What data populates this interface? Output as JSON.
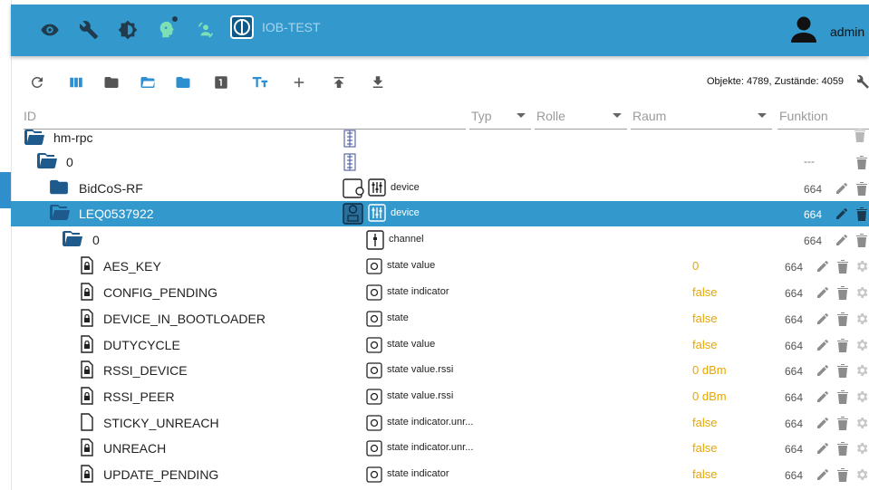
{
  "appbar": {
    "instance": "IOB-TEST",
    "user": "admin",
    "icons": [
      "eye-icon",
      "wrench-icon",
      "brightness-icon",
      "robot-head-icon",
      "person-sync-icon"
    ]
  },
  "toolbar": {
    "counts": "Objekte: 4789, Zustände: 4059",
    "icons": [
      "refresh-icon",
      "columns-icon",
      "folder-icon",
      "folder-open-icon",
      "folder-blue-icon",
      "number-one-icon",
      "text-size-icon",
      "add-icon",
      "upload-icon",
      "download-icon"
    ]
  },
  "columns": {
    "id": "ID",
    "type": "Typ",
    "role": "Rolle",
    "room": "Raum",
    "function": "Funktion"
  },
  "rows": [
    {
      "name": "hm-rpc",
      "role": "",
      "value": "",
      "acl": "",
      "selected": false
    },
    {
      "name": "0",
      "role": "",
      "value": "",
      "acl": "---",
      "selected": false
    },
    {
      "name": "BidCoS-RF",
      "role": "device",
      "value": "",
      "acl": "664",
      "selected": false
    },
    {
      "name": "LEQ0537922",
      "role": "device",
      "value": "",
      "acl": "664",
      "selected": true
    },
    {
      "name": "0",
      "role": "channel",
      "value": "",
      "acl": "664",
      "selected": false
    },
    {
      "name": "AES_KEY",
      "role": "state value",
      "value": "0",
      "acl": "664",
      "selected": false
    },
    {
      "name": "CONFIG_PENDING",
      "role": "state indicator",
      "value": "false",
      "acl": "664",
      "selected": false
    },
    {
      "name": "DEVICE_IN_BOOTLOADER",
      "role": "state",
      "value": "false",
      "acl": "664",
      "selected": false
    },
    {
      "name": "DUTYCYCLE",
      "role": "state value",
      "value": "false",
      "acl": "664",
      "selected": false
    },
    {
      "name": "RSSI_DEVICE",
      "role": "state value.rssi",
      "value": "0 dBm",
      "acl": "664",
      "selected": false
    },
    {
      "name": "RSSI_PEER",
      "role": "state value.rssi",
      "value": "0 dBm",
      "acl": "664",
      "selected": false
    },
    {
      "name": "STICKY_UNREACH",
      "role": "state indicator.unr...",
      "value": "false",
      "acl": "664",
      "selected": false
    },
    {
      "name": "UNREACH",
      "role": "state indicator.unr...",
      "value": "false",
      "acl": "664",
      "selected": false
    },
    {
      "name": "UPDATE_PENDING",
      "role": "state indicator",
      "value": "false",
      "acl": "664",
      "selected": false
    }
  ],
  "colors": {
    "accent": "#3399cc",
    "value": "#e6a700",
    "folder": "#1e5b8c"
  }
}
